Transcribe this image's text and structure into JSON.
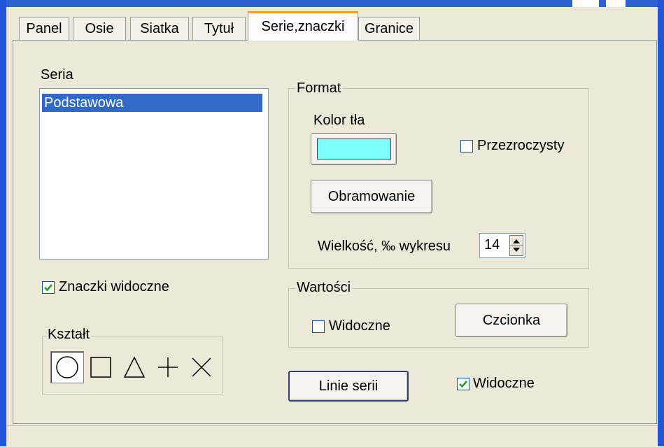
{
  "tabs": [
    {
      "label": "Panel"
    },
    {
      "label": "Osie"
    },
    {
      "label": "Siatka"
    },
    {
      "label": "Tytuł"
    },
    {
      "label": "Serie,znaczki"
    },
    {
      "label": "Granice"
    }
  ],
  "active_tab": "Serie,znaczki",
  "series": {
    "label": "Seria",
    "items": [
      "Podstawowa"
    ],
    "selected": "Podstawowa"
  },
  "markers_visible": {
    "label": "Znaczki widoczne",
    "checked": true
  },
  "shape": {
    "label": "Kształt",
    "options": [
      "circle-icon",
      "square-icon",
      "triangle-icon",
      "plus-icon",
      "cross-icon"
    ],
    "selected": "circle-icon"
  },
  "format": {
    "label": "Format",
    "bg_color_label": "Kolor tła",
    "bg_color_value": "#80ffff",
    "transparent": {
      "label": "Przezroczysty",
      "checked": false
    },
    "border_button": "Obramowanie",
    "size_label": "Wielkość, ‰ wykresu",
    "size_value": "14"
  },
  "values": {
    "label": "Wartości",
    "visible": {
      "label": "Widoczne",
      "checked": false
    },
    "font_button": "Czcionka"
  },
  "series_lines": {
    "button": "Linie serii",
    "visible": {
      "label": "Widoczne",
      "checked": true
    }
  },
  "colors": {
    "window_bg": "#ece9d8",
    "selection": "#316ac5",
    "checkmark": "#21a121",
    "tab_highlight": "#f0a030",
    "title_blue": "#1f57d6"
  }
}
